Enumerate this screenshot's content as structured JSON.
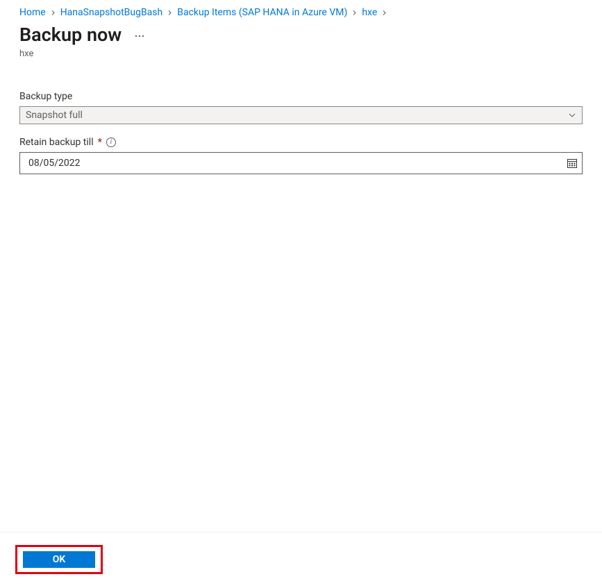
{
  "breadcrumb": {
    "items": [
      {
        "label": "Home"
      },
      {
        "label": "HanaSnapshotBugBash"
      },
      {
        "label": "Backup Items (SAP HANA in Azure VM)"
      },
      {
        "label": "hxe"
      }
    ]
  },
  "header": {
    "title": "Backup now",
    "subtitle": "hxe"
  },
  "form": {
    "backup_type": {
      "label": "Backup type",
      "value": "Snapshot full"
    },
    "retain_till": {
      "label": "Retain backup till",
      "required_marker": "*",
      "value": "08/05/2022"
    }
  },
  "footer": {
    "ok_label": "OK"
  }
}
